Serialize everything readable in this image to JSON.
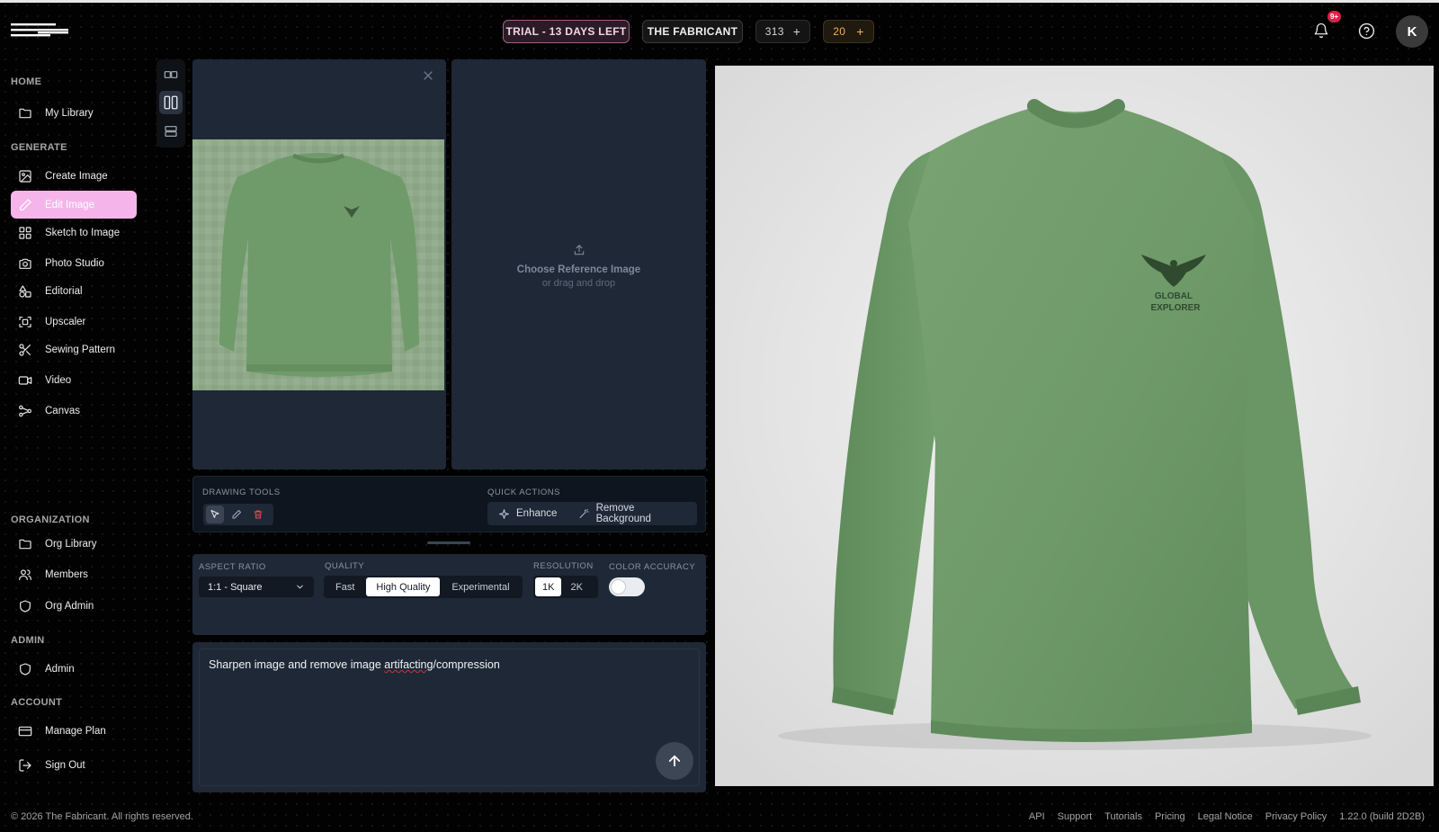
{
  "header": {
    "trial_label": "TRIAL - 13 DAYS LEFT",
    "org_label": "THE FABRICANT",
    "credits": "313",
    "bonus_credits": "20",
    "plus": "+",
    "notification_badge": "9+",
    "avatar_initial": "K"
  },
  "sidebar": {
    "sections": {
      "home": "HOME",
      "generate": "GENERATE",
      "organization": "ORGANIZATION",
      "admin": "ADMIN",
      "account": "ACCOUNT"
    },
    "items": {
      "my_library": "My Library",
      "create_image": "Create Image",
      "edit_image": "Edit Image",
      "sketch_to_image": "Sketch to Image",
      "photo_studio": "Photo Studio",
      "editorial": "Editorial",
      "upscaler": "Upscaler",
      "sewing_pattern": "Sewing Pattern",
      "video": "Video",
      "canvas": "Canvas",
      "org_library": "Org Library",
      "members": "Members",
      "org_admin": "Org Admin",
      "admin": "Admin",
      "manage_plan": "Manage Plan",
      "sign_out": "Sign Out"
    },
    "active_item": "Edit Image",
    "accent_color": "#f5b5eb"
  },
  "reference": {
    "title": "Choose Reference Image",
    "subtitle": "or drag and drop"
  },
  "tools": {
    "drawing_label": "DRAWING TOOLS",
    "quick_actions_label": "QUICK ACTIONS",
    "enhance": "Enhance",
    "remove_background": "Remove Background"
  },
  "settings": {
    "aspect_ratio_label": "ASPECT RATIO",
    "aspect_ratio_value": "1:1 - Square",
    "quality_label": "QUALITY",
    "quality_options": [
      "Fast",
      "High Quality",
      "Experimental"
    ],
    "quality_selected": "High Quality",
    "resolution_label": "RESOLUTION",
    "resolution_options": [
      "1K",
      "2K"
    ],
    "resolution_selected": "1K",
    "color_accuracy_label": "COLOR ACCURACY",
    "color_accuracy_on": false
  },
  "prompt": {
    "text_before": "Sharpen image and remove image ",
    "text_misspelled": "artifacting",
    "text_after": "/compression"
  },
  "result": {
    "logo_line1": "GLOBAL",
    "logo_line2": "EXPLORER",
    "shirt_color": "#6f9a6a"
  },
  "footer": {
    "copyright": "© 2026 The Fabricant. All rights reserved.",
    "links": {
      "api": "API",
      "support": "Support",
      "tutorials": "Tutorials",
      "pricing": "Pricing",
      "legal": "Legal Notice",
      "privacy": "Privacy Policy"
    },
    "version": "1.22.0 (build 2D2B)"
  }
}
